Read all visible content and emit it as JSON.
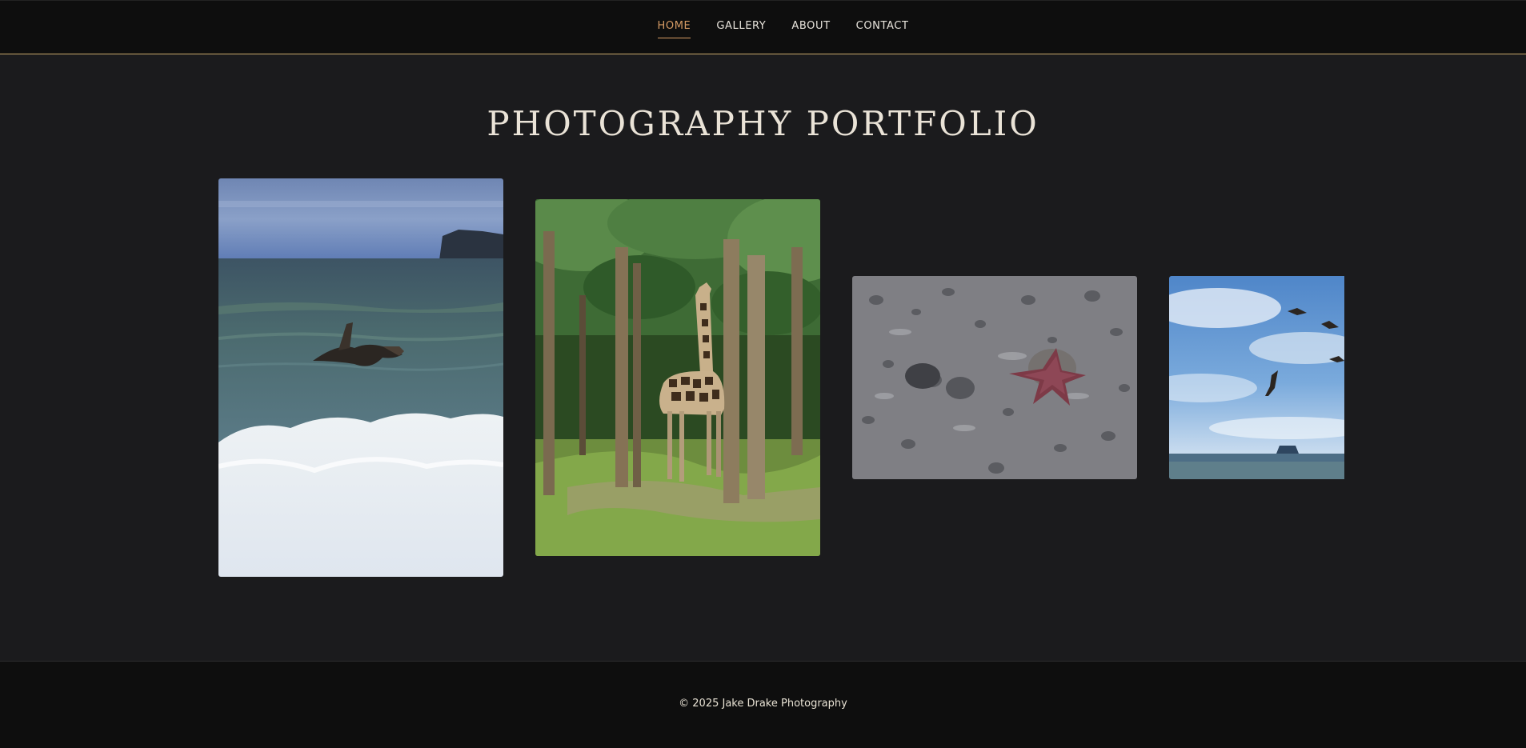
{
  "nav": {
    "items": [
      {
        "label": "HOME",
        "active": true
      },
      {
        "label": "GALLERY",
        "active": false
      },
      {
        "label": "ABOUT",
        "active": false
      },
      {
        "label": "CONTACT",
        "active": false
      }
    ],
    "accent_color": "#d69b64",
    "border_color": "#c9a96a"
  },
  "page_title": "PHOTOGRAPHY PORTFOLIO",
  "gallery": {
    "photos": [
      {
        "subject": "pelican flying over crashing ocean wave"
      },
      {
        "subject": "giraffe among palm trees"
      },
      {
        "subject": "red starfish on pebbled beach"
      },
      {
        "subject": "pelicans flying over ocean horizon"
      }
    ]
  },
  "footer": {
    "copyright": "© 2025 Jake Drake Photography"
  },
  "colors": {
    "background": "#1b1b1d",
    "nav_background": "#0e0e0e",
    "title_color": "#eae3d7"
  }
}
